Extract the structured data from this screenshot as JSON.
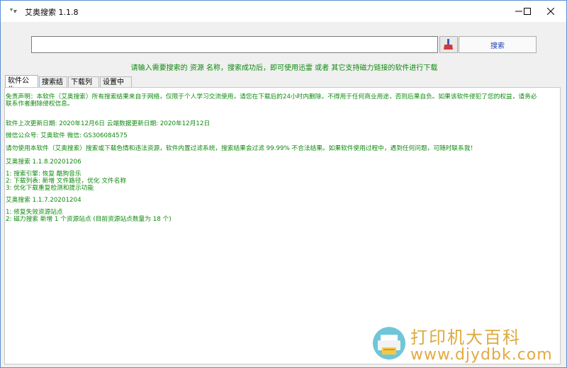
{
  "window": {
    "title": "艾奥搜索 1.1.8"
  },
  "search": {
    "placeholder": "",
    "button_label": "搜索",
    "hint": "请输入需要搜索的 资源 名称，搜索成功后，即可使用迅雷 或者 其它支持磁力链接的软件进行下载"
  },
  "tabs": [
    {
      "label": "软件公告",
      "active": true
    },
    {
      "label": "搜索结果",
      "active": false
    },
    {
      "label": "下载列表",
      "active": false
    },
    {
      "label": "设置中心",
      "active": false
    }
  ],
  "notice": {
    "lines": [
      "免责声明：本软件（艾奥搜索）所有搜索结果来自于网络，仅限于个人学习交流使用，请您在下载后的24小时内删除，不得用于任何商业用途，否则后果自负。如果该软件侵犯了您的权益，请务必",
      "联系作者删除侵权信息。",
      "",
      "软件上次更新日期: 2020年12月6日    云端数据更新日期: 2020年12月12日",
      "",
      "微信公众号: 艾奥软件    微信: GS306084575",
      "",
      "请勿使用本软件（艾奥搜索）搜索或下载色情和违法资源，软件内置过滤系统，搜索结果会过滤 99.99% 不合法结果。如果软件使用过程中，遇到任何问题，可随时联系我！",
      "",
      "艾奥搜索 1.1.8.20201206",
      "",
      "1: 搜索引擎: 恢复 酷狗音乐",
      "2: 下载列表: 新增 文件路径，优化 文件名称",
      "3: 优化下载重复检测和提示功能",
      "",
      "艾奥搜索 1.1.7.20201204",
      "",
      "1: 修复失效资源站点",
      "2: 磁力搜索 新增 1 个资源站点 (目前资源站点数量为 18 个)"
    ]
  },
  "watermark": {
    "line1": "打印机大百科",
    "line2": "www.djydbk.com"
  },
  "colors": {
    "text_green": "#0e8a0e",
    "search_blue": "#1a3fb5",
    "window_border": "#5b8fd4",
    "watermark_orange": "#e0a02e"
  },
  "icons": [
    "app-icon",
    "minimize-icon",
    "maximize-icon",
    "close-icon",
    "brush-icon",
    "printer-icon"
  ]
}
